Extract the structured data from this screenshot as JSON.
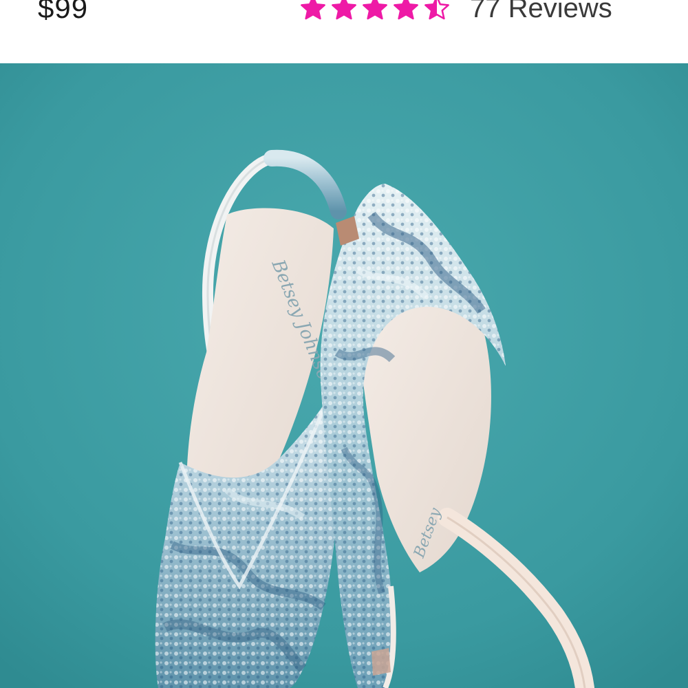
{
  "product": {
    "price": "$99",
    "rating": 4.5,
    "rating_max": 5,
    "reviews_text": "77 Reviews",
    "brand_signature": "Betsey Johnson"
  },
  "colors": {
    "star_accent": "#ee1aa6",
    "background_teal": "#3d9ea3",
    "price_text": "#1a1a1a"
  },
  "icons": {
    "full_star": "star-full-icon",
    "half_star": "star-half-icon"
  }
}
